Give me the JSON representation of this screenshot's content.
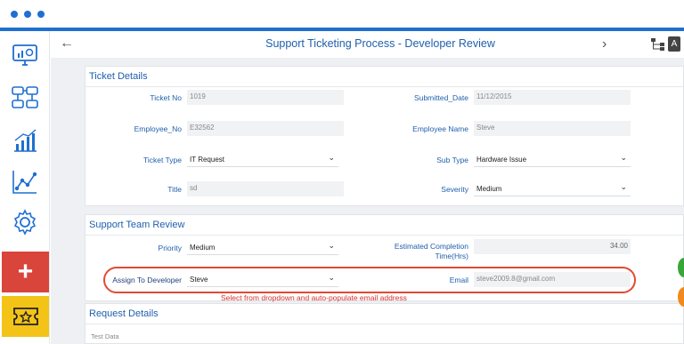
{
  "header": {
    "title": "Support Ticketing Process - Developer Review",
    "pdf_label": "A"
  },
  "sidebar": {
    "add_label": "+"
  },
  "ticket_details": {
    "title": "Ticket Details",
    "ticket_no_label": "Ticket No",
    "ticket_no": "1019",
    "submitted_date_label": "Submitted_Date",
    "submitted_date": "11/12/2015",
    "employee_no_label": "Employee_No",
    "employee_no": "E32562",
    "employee_name_label": "Employee Name",
    "employee_name": "Steve",
    "ticket_type_label": "Ticket Type",
    "ticket_type": "IT Request",
    "sub_type_label": "Sub Type",
    "sub_type": "Hardware Issue",
    "title_label": "Title",
    "title_value": "sd",
    "severity_label": "Severity",
    "severity": "Medium"
  },
  "support_review": {
    "title": "Support Team Review",
    "priority_label": "Priority",
    "priority": "Medium",
    "completion_label_1": "Estimated Completion",
    "completion_label_2": "Time(Hrs)",
    "completion_value": "34.00",
    "assign_label": "Assign To Developer",
    "assign_value": "Steve",
    "email_label": "Email",
    "email_value": "steve2009.8@gmail.com"
  },
  "annotation": {
    "text": "Select from dropdown and auto-populate email address"
  },
  "request_details": {
    "title": "Request Details",
    "test_data": "Test Data"
  },
  "colors": {
    "accent": "#1f6fd1",
    "label": "#1f5fad",
    "add": "#d9443b",
    "star": "#f3c318",
    "annotation": "#e24a33"
  }
}
